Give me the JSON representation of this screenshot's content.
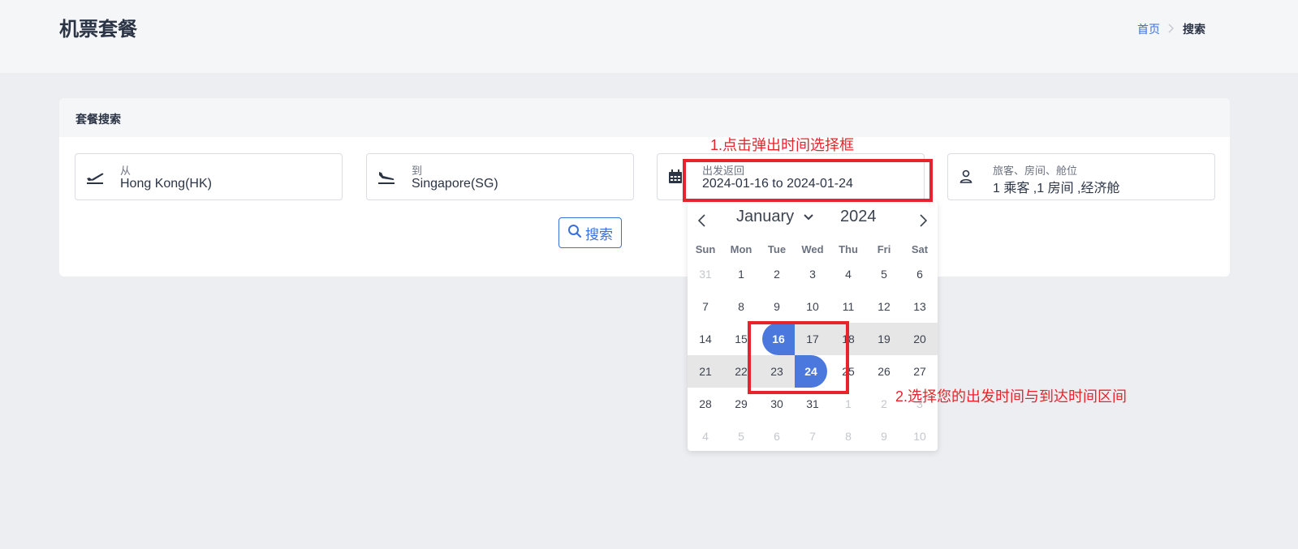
{
  "header": {
    "title": "机票套餐",
    "breadcrumb": {
      "home": "首页",
      "current": "搜索"
    }
  },
  "card": {
    "title": "套餐搜索",
    "fields": {
      "from": {
        "label": "从",
        "value": "Hong Kong(HK)",
        "icon": "plane-takeoff-icon"
      },
      "to": {
        "label": "到",
        "value": "Singapore(SG)",
        "icon": "plane-landing-icon"
      },
      "dates": {
        "label": "出发返回",
        "value": "2024-01-16 to 2024-01-24",
        "icon": "calendar-icon"
      },
      "travelers": {
        "label": "旅客、房间、舱位",
        "value": "1 乘客 ,1 房间 ,经济舱",
        "icon": "user-icon"
      }
    },
    "search_button": {
      "label": "搜索",
      "icon": "search-icon"
    }
  },
  "calendar": {
    "month": "January",
    "year": "2024",
    "weekdays": [
      "Sun",
      "Mon",
      "Tue",
      "Wed",
      "Thu",
      "Fri",
      "Sat"
    ],
    "days": [
      {
        "d": "31",
        "s": "muted"
      },
      {
        "d": "1",
        "s": ""
      },
      {
        "d": "2",
        "s": ""
      },
      {
        "d": "3",
        "s": ""
      },
      {
        "d": "4",
        "s": ""
      },
      {
        "d": "5",
        "s": ""
      },
      {
        "d": "6",
        "s": ""
      },
      {
        "d": "7",
        "s": ""
      },
      {
        "d": "8",
        "s": ""
      },
      {
        "d": "9",
        "s": ""
      },
      {
        "d": "10",
        "s": ""
      },
      {
        "d": "11",
        "s": ""
      },
      {
        "d": "12",
        "s": ""
      },
      {
        "d": "13",
        "s": ""
      },
      {
        "d": "14",
        "s": ""
      },
      {
        "d": "15",
        "s": ""
      },
      {
        "d": "16",
        "s": "start"
      },
      {
        "d": "17",
        "s": "inrange"
      },
      {
        "d": "18",
        "s": "inrange"
      },
      {
        "d": "19",
        "s": "inrange"
      },
      {
        "d": "20",
        "s": "inrange"
      },
      {
        "d": "21",
        "s": "inrange"
      },
      {
        "d": "22",
        "s": "inrange"
      },
      {
        "d": "23",
        "s": "inrange"
      },
      {
        "d": "24",
        "s": "end"
      },
      {
        "d": "25",
        "s": ""
      },
      {
        "d": "26",
        "s": ""
      },
      {
        "d": "27",
        "s": ""
      },
      {
        "d": "28",
        "s": ""
      },
      {
        "d": "29",
        "s": ""
      },
      {
        "d": "30",
        "s": ""
      },
      {
        "d": "31",
        "s": ""
      },
      {
        "d": "1",
        "s": "muted"
      },
      {
        "d": "2",
        "s": "muted"
      },
      {
        "d": "3",
        "s": "muted"
      },
      {
        "d": "4",
        "s": "muted"
      },
      {
        "d": "5",
        "s": "muted"
      },
      {
        "d": "6",
        "s": "muted"
      },
      {
        "d": "7",
        "s": "muted"
      },
      {
        "d": "8",
        "s": "muted"
      },
      {
        "d": "9",
        "s": "muted"
      },
      {
        "d": "10",
        "s": "muted"
      }
    ]
  },
  "annotations": {
    "step1": "1.点击弹出时间选择框",
    "step2": "2.选择您的出发时间与到达时间区间"
  },
  "colors": {
    "accent": "#3b6fd9",
    "selected": "#4a78dd",
    "range": "#e6e6e6",
    "annotation": "#e8232b"
  }
}
